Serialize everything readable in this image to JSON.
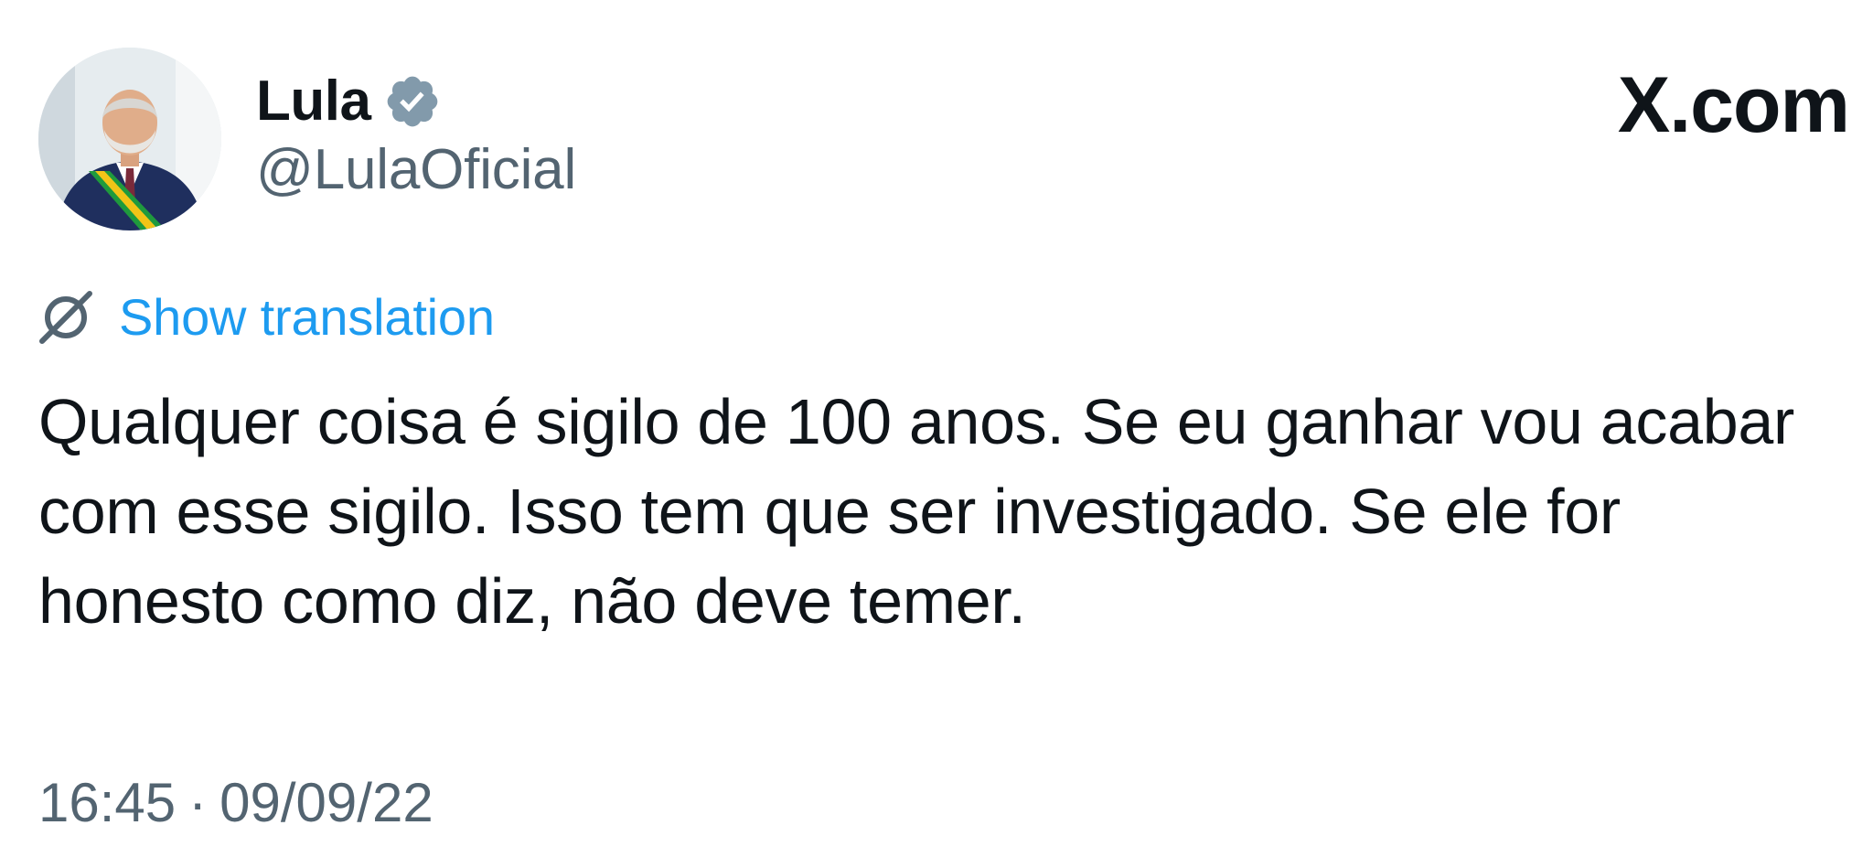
{
  "author": {
    "name": "Lula",
    "handle": "@LulaOficial",
    "verified": true
  },
  "brand": {
    "label": "X.com"
  },
  "translation": {
    "label": "Show translation"
  },
  "tweet": {
    "text": "Qualquer coisa é sigilo de 100 anos. Se eu ganhar vou acabar com esse sigilo. Isso tem que ser investigado. Se ele for honesto como diz, não deve temer.",
    "time": "16:45",
    "separator": "·",
    "date": "09/09/22"
  },
  "colors": {
    "link": "#1d9bf0",
    "text": "#0f1419",
    "secondary": "#536471",
    "verified_badge": "#829aab"
  },
  "icons": {
    "verified": "verified-badge-icon",
    "translation": "globe-icon"
  }
}
